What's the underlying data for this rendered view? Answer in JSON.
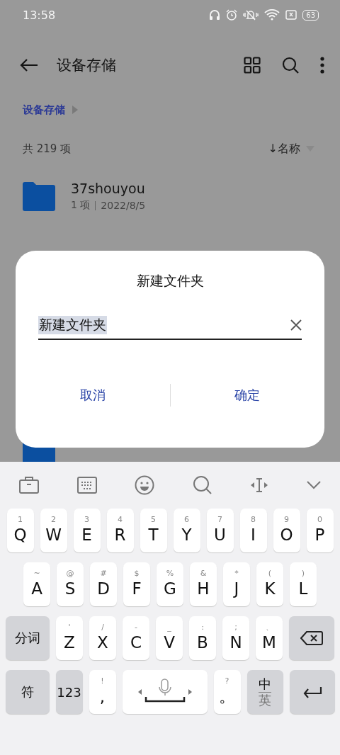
{
  "status_bar": {
    "time": "13:58",
    "battery": "63"
  },
  "app_bar": {
    "title": "设备存储"
  },
  "breadcrumb": [
    "设备存储"
  ],
  "summary": {
    "count": "共 219 项",
    "sort": "↓名称"
  },
  "files": [
    {
      "kind": "folder",
      "name": "37shouyou",
      "meta": [
        "1 项",
        "2022/8/5"
      ]
    },
    {
      "kind": "folder"
    }
  ],
  "dialog": {
    "title": "新建文件夹",
    "field": {
      "value": "新建文件夹"
    },
    "buttons": [
      "取消",
      "确定"
    ]
  },
  "keyboard": {
    "rows": [
      [
        {
          "kind": "letter",
          "hint": "1",
          "label": "Q"
        },
        {
          "kind": "letter",
          "hint": "2",
          "label": "W"
        },
        {
          "kind": "letter",
          "hint": "3",
          "label": "E"
        },
        {
          "kind": "letter",
          "hint": "4",
          "label": "R"
        },
        {
          "kind": "letter",
          "hint": "5",
          "label": "T"
        },
        {
          "kind": "letter",
          "hint": "6",
          "label": "Y"
        },
        {
          "kind": "letter",
          "hint": "7",
          "label": "U"
        },
        {
          "kind": "letter",
          "hint": "8",
          "label": "I"
        },
        {
          "kind": "letter",
          "hint": "9",
          "label": "O"
        },
        {
          "kind": "letter",
          "hint": "0",
          "label": "P"
        }
      ],
      [
        {
          "kind": "letter",
          "hint": "~",
          "label": "A"
        },
        {
          "kind": "letter",
          "hint": "@",
          "label": "S"
        },
        {
          "kind": "letter",
          "hint": "#",
          "label": "D"
        },
        {
          "kind": "letter",
          "hint": "$",
          "label": "F"
        },
        {
          "kind": "letter",
          "hint": "%",
          "label": "G"
        },
        {
          "kind": "letter",
          "hint": "&",
          "label": "H"
        },
        {
          "kind": "letter",
          "hint": "*",
          "label": "J"
        },
        {
          "kind": "letter",
          "hint": "(",
          "label": "K"
        },
        {
          "kind": "letter",
          "hint": ")",
          "label": "L"
        }
      ],
      [
        {
          "kind": "function",
          "label": "分词"
        },
        {
          "kind": "letter",
          "hint": "'",
          "label": "Z"
        },
        {
          "kind": "letter",
          "hint": "/",
          "label": "X"
        },
        {
          "kind": "letter",
          "hint": "-",
          "label": "C"
        },
        {
          "kind": "letter",
          "hint": "_",
          "label": "V"
        },
        {
          "kind": "letter",
          "hint": ":",
          "label": "B"
        },
        {
          "kind": "letter",
          "hint": ";",
          "label": "N"
        },
        {
          "kind": "letter",
          "hint": "、",
          "label": "M"
        },
        {
          "kind": "backspace"
        }
      ],
      [
        {
          "kind": "function",
          "label": "符"
        },
        {
          "kind": "function",
          "label": "123"
        },
        {
          "kind": "letter",
          "hint": "!",
          "label": ","
        },
        {
          "kind": "space"
        },
        {
          "kind": "letter",
          "hint": "?",
          "label": "。"
        },
        {
          "kind": "lang",
          "label": "中",
          "sub": "英"
        },
        {
          "kind": "enter"
        }
      ]
    ]
  }
}
